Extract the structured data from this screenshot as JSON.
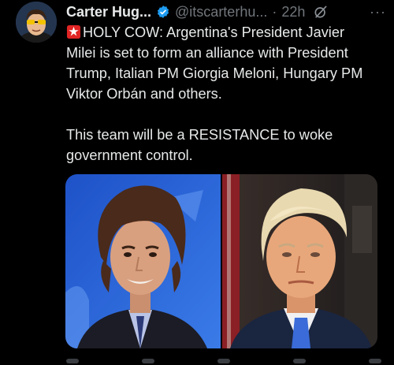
{
  "author": {
    "name": "Carter Hug...",
    "handle": "@itscarterhu...",
    "separator": "·",
    "time": "22h",
    "verified_color": "#1d9bf0"
  },
  "tweet": {
    "lines": [
      "HOLY COW: Argentina's President Javier",
      "Milei is set to form an alliance with President",
      "Trump, Italian PM Giorgia Meloni, Hungary PM",
      "Viktor Orbán and others.",
      "This team will be a RESISTANCE to woke",
      "government control."
    ]
  },
  "actions": {
    "more_label": "···"
  },
  "icons": {
    "siren": "siren-emoji-icon",
    "verified": "verified-badge-icon",
    "grok": "grok-icon",
    "more": "more-options-icon"
  },
  "colors": {
    "background": "#000000",
    "text": "#e7e9ea",
    "muted": "#71767b",
    "accent": "#1d9bf0"
  }
}
